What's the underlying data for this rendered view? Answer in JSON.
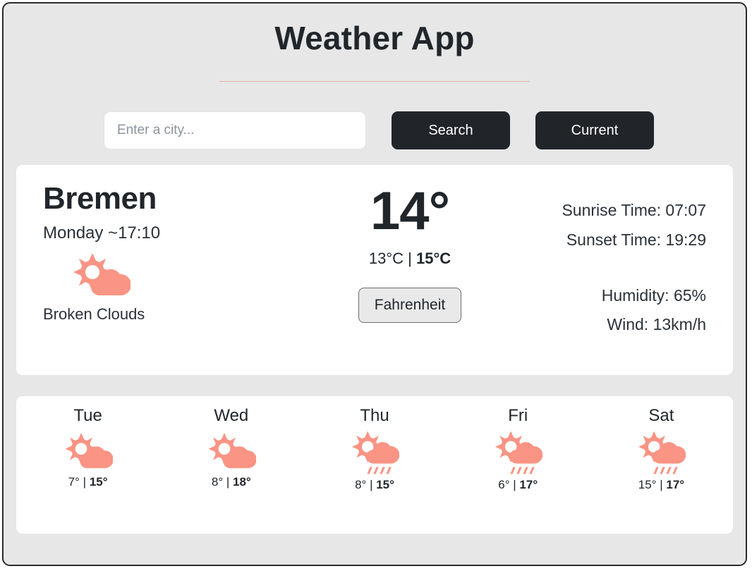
{
  "header": {
    "title": "Weather App"
  },
  "search": {
    "placeholder": "Enter a city...",
    "value": "",
    "search_label": "Search",
    "current_label": "Current"
  },
  "current": {
    "city": "Bremen",
    "day_time": "Monday ~17:10",
    "condition": "Broken Clouds",
    "condition_icon": "sun-cloud-icon",
    "temperature": "14°",
    "temp_min": "13°C",
    "temp_separator": "|",
    "temp_max": "15°C",
    "unit_button_label": "Fahrenheit",
    "sunrise": "Sunrise Time: 07:07",
    "sunset": "Sunset Time: 19:29",
    "humidity": "Humidity: 65%",
    "wind": "Wind: 13km/h"
  },
  "forecast": [
    {
      "day": "Tue",
      "icon": "sun-cloud-icon",
      "min": "7°",
      "sep": "|",
      "max": "15°"
    },
    {
      "day": "Wed",
      "icon": "sun-cloud-icon",
      "min": "8°",
      "sep": "|",
      "max": "18°"
    },
    {
      "day": "Thu",
      "icon": "sun-cloud-rain-icon",
      "min": "8°",
      "sep": "|",
      "max": "15°"
    },
    {
      "day": "Fri",
      "icon": "sun-cloud-rain-icon",
      "min": "6°",
      "sep": "|",
      "max": "17°"
    },
    {
      "day": "Sat",
      "icon": "sun-cloud-rain-icon",
      "min": "15°",
      "sep": "|",
      "max": "17°"
    }
  ],
  "colors": {
    "accent": "#fa9484",
    "divider": "#e7b2a4",
    "button_dark": "#212529",
    "app_background": "#e7e7e7",
    "card_background": "#ffffff",
    "text": "#21262b"
  }
}
